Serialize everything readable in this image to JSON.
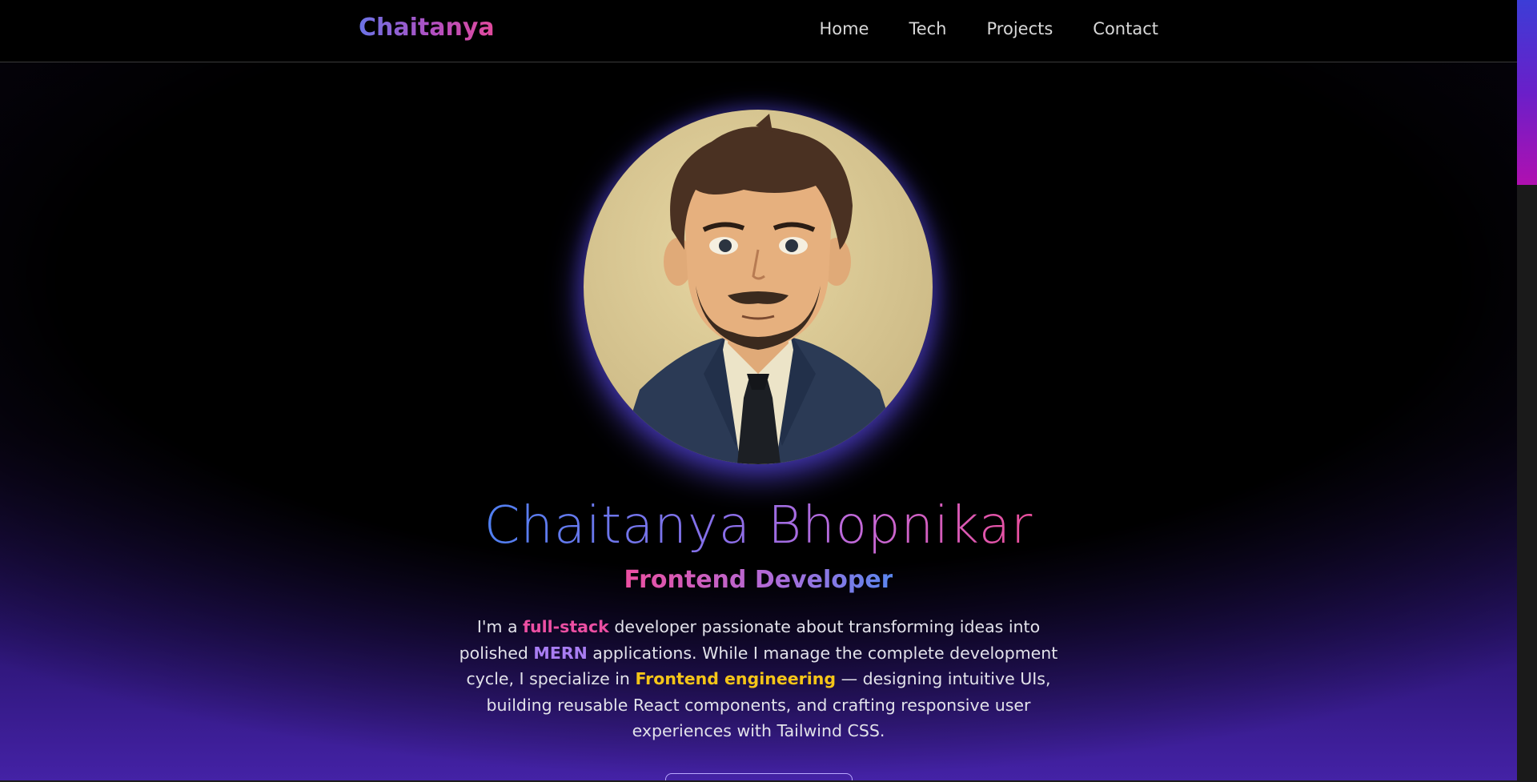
{
  "brand": {
    "name": "Chaitanya"
  },
  "nav": {
    "items": [
      {
        "label": "Home"
      },
      {
        "label": "Tech"
      },
      {
        "label": "Projects"
      },
      {
        "label": "Contact"
      }
    ]
  },
  "hero": {
    "name": "Chaitanya Bhopnikar",
    "role": "Frontend Developer",
    "bio": {
      "part1": "I'm a ",
      "highlight1": "full-stack",
      "part2": " developer passionate about transforming ideas into polished ",
      "highlight2": "MERN",
      "part3": " applications. While I manage the complete development cycle, I specialize in ",
      "highlight3": "Frontend engineering",
      "part4": " — designing intuitive UIs, building reusable React components, and crafting responsive user experiences with Tailwind CSS."
    }
  },
  "colors": {
    "background": "#000000",
    "accent_pink": "#ec4fa3",
    "accent_purple": "#a87df2",
    "accent_gold": "#f5c518",
    "accent_blue": "#4f7ff0"
  },
  "icons": {
    "avatar": "profile-portrait-illustration"
  }
}
